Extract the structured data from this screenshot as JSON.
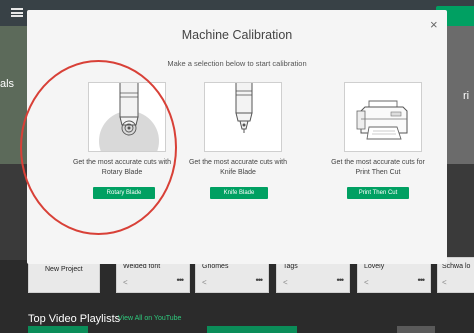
{
  "modal": {
    "title": "Machine Calibration",
    "subtitle": "Make a selection below to start calibration",
    "close_icon": "×",
    "options": [
      {
        "line1": "Get the most accurate cuts with",
        "line2": "Rotary Blade",
        "button": "Rotary Blade",
        "icon": "rotary-blade-icon"
      },
      {
        "line1": "Get the most accurate cuts with",
        "line2": "Knife Blade",
        "button": "Knife Blade",
        "icon": "knife-blade-icon"
      },
      {
        "line1": "Get the most accurate cuts for",
        "line2": "Print Then Cut",
        "button": "Print Then Cut",
        "icon": "printer-icon"
      }
    ]
  },
  "background": {
    "left_text": "als",
    "right_text": "ri",
    "cards": [
      {
        "name": "New Project"
      },
      {
        "name": "Welded font"
      },
      {
        "name": "Gnomes"
      },
      {
        "name": "Tags"
      },
      {
        "name": "Lovely"
      },
      {
        "name": "Schwa lo"
      }
    ],
    "playlists_heading": "Top Video Playlists",
    "view_all": "View All on YouTube"
  },
  "colors": {
    "accent": "#00a062",
    "highlight_circle": "#d84037",
    "topbar": "#384146"
  }
}
